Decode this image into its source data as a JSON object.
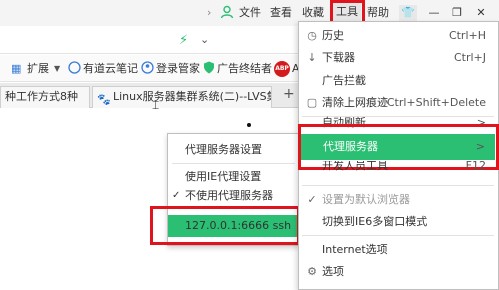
{
  "topbar": {
    "file": "文件",
    "view": "查看",
    "favorites": "收藏",
    "tools": "工具",
    "help": "帮助"
  },
  "bookmarks": {
    "expand": "扩展",
    "youdao": "有道云笔记",
    "login": "登录管家",
    "adblock": "广告终结者",
    "abp_badge": "ABP",
    "trailing": "A"
  },
  "tabs": [
    {
      "label": "种工作方式8种"
    },
    {
      "label": "Linux服务器集群系统(二)--LVS集"
    }
  ],
  "tools_menu": {
    "items": [
      {
        "icon": "history-icon",
        "label": "历史",
        "shortcut": "Ctrl+H"
      },
      {
        "icon": "download-icon",
        "label": "下载器",
        "shortcut": "Ctrl+J"
      },
      {
        "icon": "",
        "label": "广告拦截",
        "shortcut": ""
      },
      {
        "icon": "clear-icon",
        "label": "清除上网痕迹",
        "shortcut": "Ctrl+Shift+Delete"
      },
      {
        "icon": "",
        "label": "自动刷新",
        "shortcut": ">"
      },
      {
        "icon": "",
        "label": "代理服务器",
        "shortcut": ">"
      },
      {
        "icon": "",
        "label": "开发人员工具",
        "shortcut": "F12"
      },
      {
        "icon": "check-icon",
        "label": "设置为默认浏览器",
        "shortcut": ""
      },
      {
        "icon": "",
        "label": "切换到IE6多窗口模式",
        "shortcut": ""
      },
      {
        "icon": "",
        "label": "Internet选项",
        "shortcut": ""
      },
      {
        "icon": "gear-icon",
        "label": "选项",
        "shortcut": ""
      }
    ]
  },
  "proxy_submenu": {
    "items": [
      {
        "label": "代理服务器设置"
      },
      {
        "label": "使用IE代理设置"
      },
      {
        "label": "不使用代理服务器"
      },
      {
        "label": "127.0.0.1:6666 ssh"
      }
    ]
  },
  "colors": {
    "highlight": "#2bbf73",
    "annotation": "#e0141d"
  }
}
